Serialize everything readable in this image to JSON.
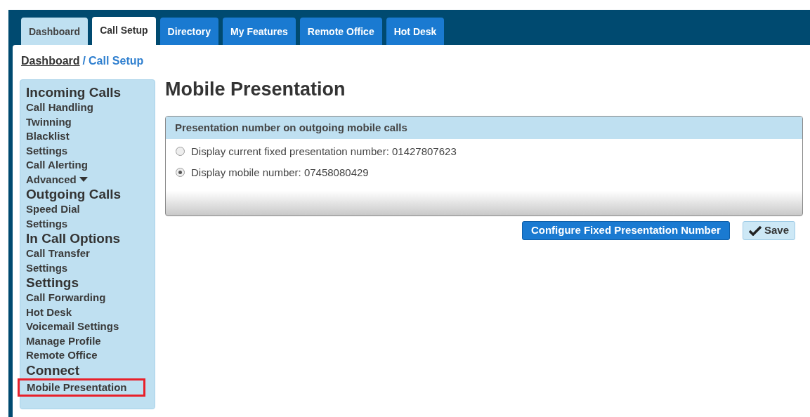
{
  "tabs": [
    {
      "label": "Dashboard",
      "kind": "light",
      "selected": false
    },
    {
      "label": "Call Setup",
      "kind": "light",
      "selected": true
    },
    {
      "label": "Directory",
      "kind": "primary",
      "selected": false
    },
    {
      "label": "My Features",
      "kind": "primary",
      "selected": false
    },
    {
      "label": "Remote Office",
      "kind": "primary",
      "selected": false
    },
    {
      "label": "Hot Desk",
      "kind": "primary",
      "selected": false
    }
  ],
  "breadcrumb": {
    "link": "Dashboard",
    "separator": "/",
    "current": "Call Setup"
  },
  "sidebar": {
    "sections": [
      {
        "title": "Incoming Calls",
        "items": [
          {
            "label": "Call Handling",
            "highlighted": false
          },
          {
            "label": "Twinning",
            "highlighted": false
          },
          {
            "label": "Blacklist",
            "highlighted": false
          },
          {
            "label": "Settings",
            "highlighted": false
          },
          {
            "label": "Call Alerting",
            "highlighted": false
          },
          {
            "label": "Advanced",
            "highlighted": false,
            "dropdown": true
          }
        ]
      },
      {
        "title": "Outgoing Calls",
        "items": [
          {
            "label": "Speed Dial",
            "highlighted": false
          },
          {
            "label": "Settings",
            "highlighted": false
          }
        ]
      },
      {
        "title": "In Call Options",
        "items": [
          {
            "label": "Call Transfer",
            "highlighted": false
          },
          {
            "label": "Settings",
            "highlighted": false
          }
        ]
      },
      {
        "title": "Settings",
        "items": [
          {
            "label": "Call Forwarding",
            "highlighted": false
          },
          {
            "label": "Hot Desk",
            "highlighted": false
          },
          {
            "label": "Voicemail Settings",
            "highlighted": false
          },
          {
            "label": "Manage Profile",
            "highlighted": false
          },
          {
            "label": "Remote Office",
            "highlighted": false
          }
        ]
      },
      {
        "title": "Connect",
        "items": [
          {
            "label": "Mobile Presentation",
            "highlighted": true
          }
        ]
      }
    ]
  },
  "page_title": "Mobile Presentation",
  "panel": {
    "heading": "Presentation number on outgoing mobile calls",
    "options": [
      {
        "label": "Display current fixed presentation number: 01427807623",
        "selected": false
      },
      {
        "label": "Display mobile number: 07458080429",
        "selected": true
      }
    ]
  },
  "buttons": [
    {
      "label": "Configure Fixed Presentation Number",
      "kind": "primary"
    },
    {
      "label": "Save",
      "kind": "save"
    }
  ]
}
